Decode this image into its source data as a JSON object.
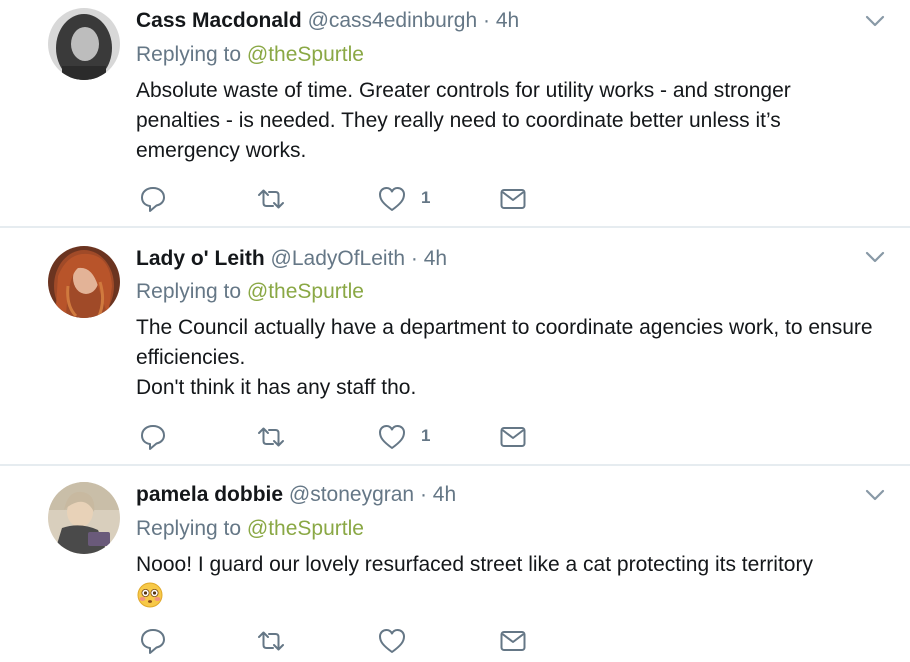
{
  "tweets": [
    {
      "name": "Cass Macdonald",
      "handle": "@cass4edinburgh",
      "dot": " · ",
      "time": "4h",
      "reply_prefix": "Replying to ",
      "reply_to": "@theSpurtle",
      "lines": [
        "Absolute waste of time. Greater controls for utility works - and stronger penalties - is needed. They really need to coordinate better unless it’s emergency works."
      ],
      "like_count": "1",
      "avatar": "avatar-cass"
    },
    {
      "name": "Lady o' Leith",
      "handle": "@LadyOfLeith",
      "dot": " · ",
      "time": "4h",
      "reply_prefix": "Replying to ",
      "reply_to": "@theSpurtle",
      "lines": [
        "The Council actually have a department to coordinate agencies work, to ensure efficiencies.",
        "Don't think it has any staff tho."
      ],
      "like_count": "1",
      "avatar": "avatar-lady"
    },
    {
      "name": "pamela dobbie",
      "handle": "@stoneygran",
      "dot": " · ",
      "time": "4h",
      "reply_prefix": "Replying to ",
      "reply_to": "@theSpurtle",
      "lines": [
        "Nooo! I guard our lovely resurfaced street like a cat protecting its territory"
      ],
      "emoji": "flushed-face-emoji",
      "like_count": "",
      "avatar": "avatar-pamela"
    }
  ],
  "icons": {
    "reply": "reply-icon",
    "retweet": "retweet-icon",
    "like": "heart-icon",
    "dm": "envelope-icon",
    "more": "chevron-down-icon"
  },
  "colors": {
    "muted": "#657786",
    "mention": "#8aa845",
    "divider": "#e6ecf0"
  }
}
